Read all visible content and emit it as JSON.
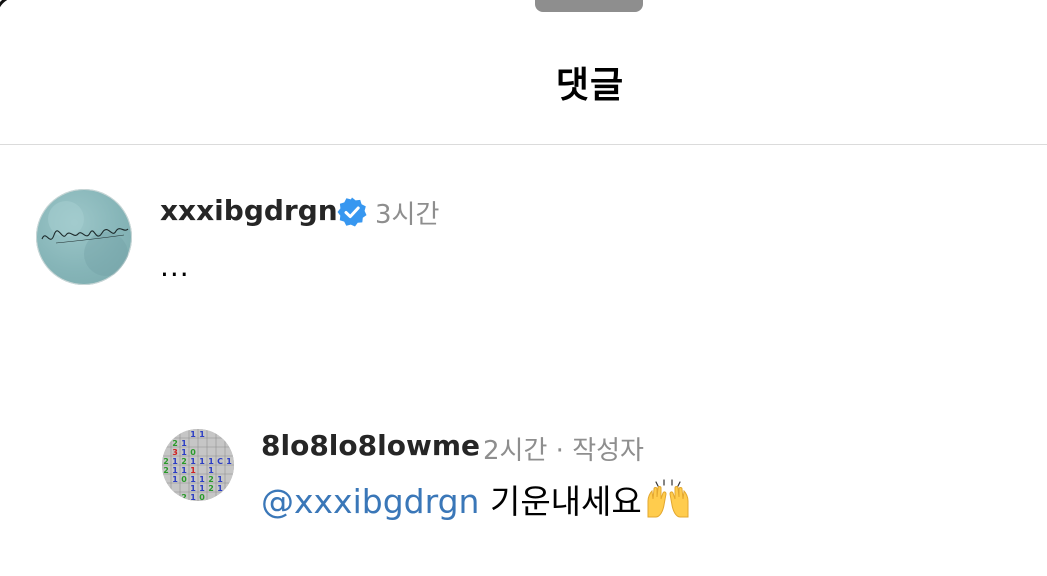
{
  "header": {
    "title": "댓글"
  },
  "comment": {
    "avatar_icon": "signature-avatar-icon",
    "username": "xxxibgdrgn",
    "verified_icon": "verified-badge-icon",
    "time": "3시간",
    "text": "..."
  },
  "reply": {
    "avatar_icon": "minesweeper-avatar-icon",
    "username": "8lo8lo8lowme",
    "time": "2시간",
    "separator": "·",
    "author_label": "작성자",
    "mention": "@xxxibgdrgn",
    "text": "기운내세요",
    "emoji": "raising-hands-emoji"
  },
  "colors": {
    "mention": "#3a77b8",
    "verified": "#3797f0",
    "secondary_text": "#8e8e8e",
    "divider": "#dbdbdb"
  }
}
